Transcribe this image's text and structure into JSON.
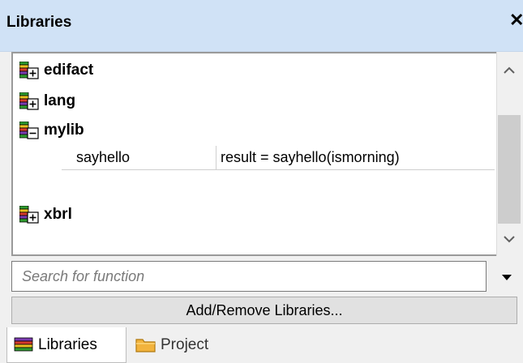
{
  "window": {
    "title": "Libraries",
    "close_glyph": "✕"
  },
  "libraries": [
    {
      "label": "edifact",
      "expanded": false,
      "icon": "library-collapsed-icon"
    },
    {
      "label": "lang",
      "expanded": false,
      "icon": "library-collapsed-icon"
    },
    {
      "label": "mylib",
      "expanded": true,
      "icon": "library-expanded-icon",
      "functions": [
        {
          "name": "sayhello",
          "signature": "result = sayhello(ismorning)"
        }
      ]
    },
    {
      "label": "xbrl",
      "expanded": false,
      "icon": "library-collapsed-icon"
    }
  ],
  "search": {
    "placeholder": "Search for function",
    "value": ""
  },
  "add_remove_label": "Add/Remove Libraries...",
  "tabs": [
    {
      "label": "Libraries",
      "active": true,
      "icon": "libraries-tab-icon"
    },
    {
      "label": "Project",
      "active": false,
      "icon": "folder-icon"
    }
  ],
  "colors": {
    "titlebar": "#d0e2f6",
    "folder": "#f2b33d",
    "book_green": "#2e9b2e",
    "book_red": "#d63b2b",
    "book_purple": "#7a3bb0"
  }
}
